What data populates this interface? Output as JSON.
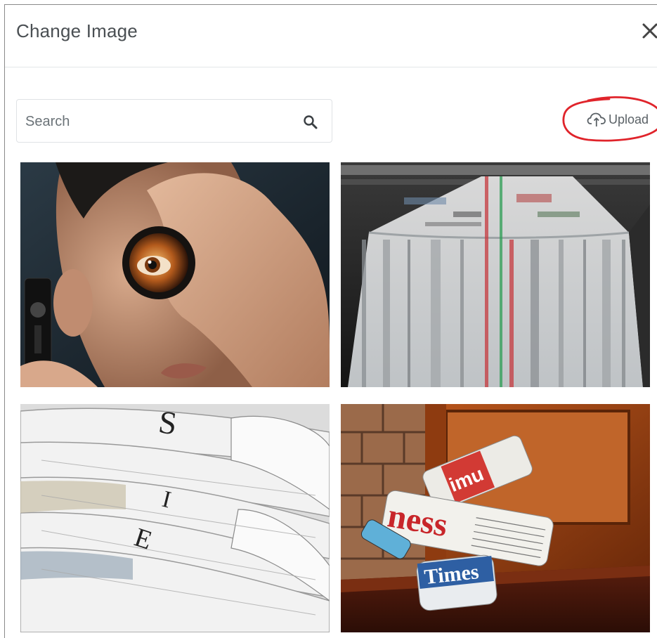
{
  "dialog": {
    "title": "Change Image",
    "close_icon": "close-icon"
  },
  "search": {
    "placeholder": "Search",
    "value": "",
    "icon": "search-icon"
  },
  "upload": {
    "label": "Upload",
    "icon": "cloud-upload-icon",
    "annotation_color": "#e0242b"
  },
  "images": [
    {
      "subject": "man holding magnifying lens over eye"
    },
    {
      "subject": "newspapers moving on printing press"
    },
    {
      "subject": "stack of folded newspapers"
    },
    {
      "subject": "rolled newspapers on doorstep"
    }
  ],
  "colors": {
    "title_text": "#4a4f53",
    "border": "#dfe2e5",
    "upload_text": "#5a6166"
  }
}
